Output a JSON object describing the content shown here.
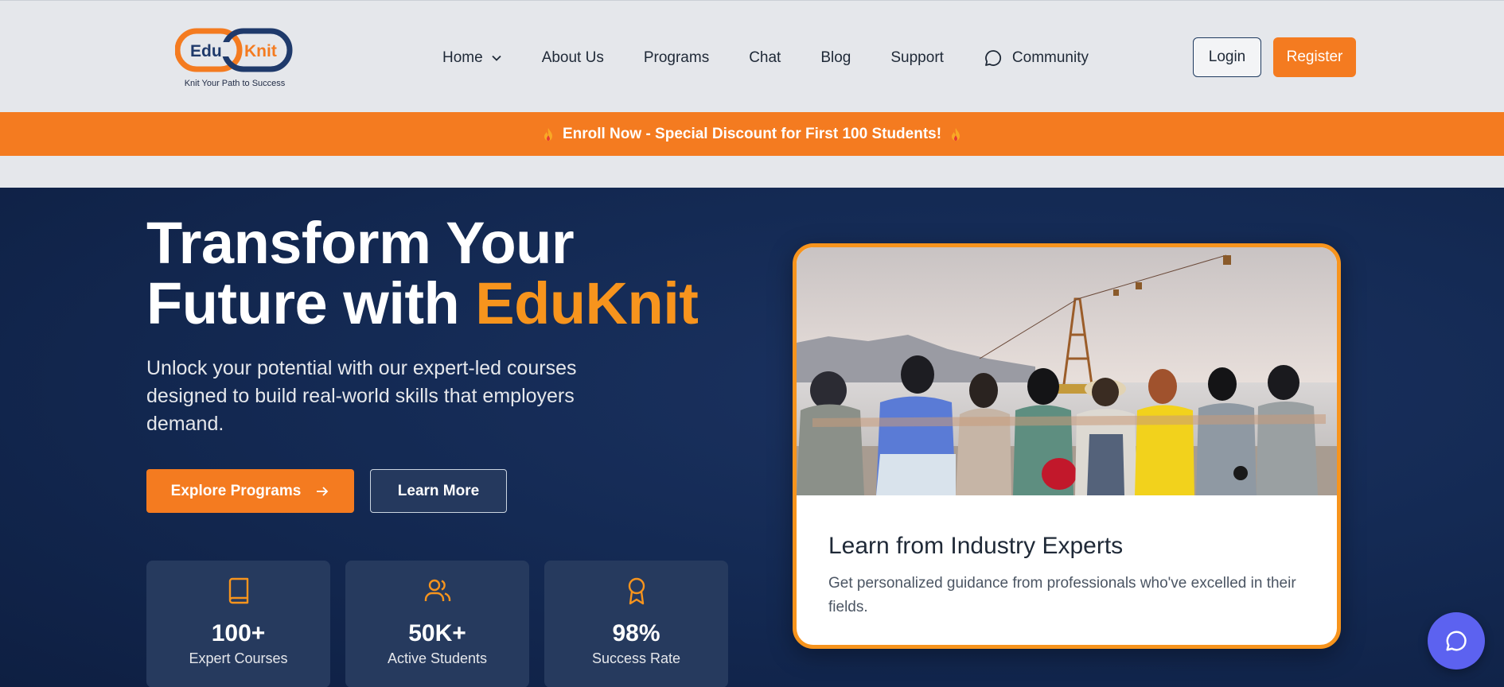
{
  "logo": {
    "text_left": "Edu",
    "text_right": "Knit",
    "tagline": "Knit Your Path to Success"
  },
  "nav": {
    "items": [
      {
        "label": "Home",
        "icon": "chevron-down-icon"
      },
      {
        "label": "About Us"
      },
      {
        "label": "Programs"
      },
      {
        "label": "Chat"
      },
      {
        "label": "Blog"
      },
      {
        "label": "Support"
      },
      {
        "label": "Community",
        "icon": "chat-bubble-icon"
      }
    ]
  },
  "auth": {
    "login_label": "Login",
    "register_label": "Register"
  },
  "promo": {
    "text": "Enroll Now - Special Discount for First 100 Students!",
    "icon": "fire-icon"
  },
  "hero": {
    "headline_line1": "Transform Your",
    "headline_line2_prefix": "Future with ",
    "headline_accent": "EduKnit",
    "subtext": "Unlock your potential with our expert-led courses designed to build real-world skills that employers demand.",
    "explore_label": "Explore Programs",
    "learn_more_label": "Learn More"
  },
  "stats": [
    {
      "value": "100+",
      "label": "Expert Courses",
      "icon": "book-icon"
    },
    {
      "value": "50K+",
      "label": "Active Students",
      "icon": "users-icon"
    },
    {
      "value": "98%",
      "label": "Success Rate",
      "icon": "award-icon"
    }
  ],
  "feature_card": {
    "title": "Learn from Industry Experts",
    "description": "Get personalized guidance from professionals who've excelled in their fields."
  },
  "colors": {
    "brand_orange": "#f47b20",
    "accent_orange": "#f7941d",
    "hero_navy": "#142a54",
    "chat_fab": "#5c62f0"
  }
}
